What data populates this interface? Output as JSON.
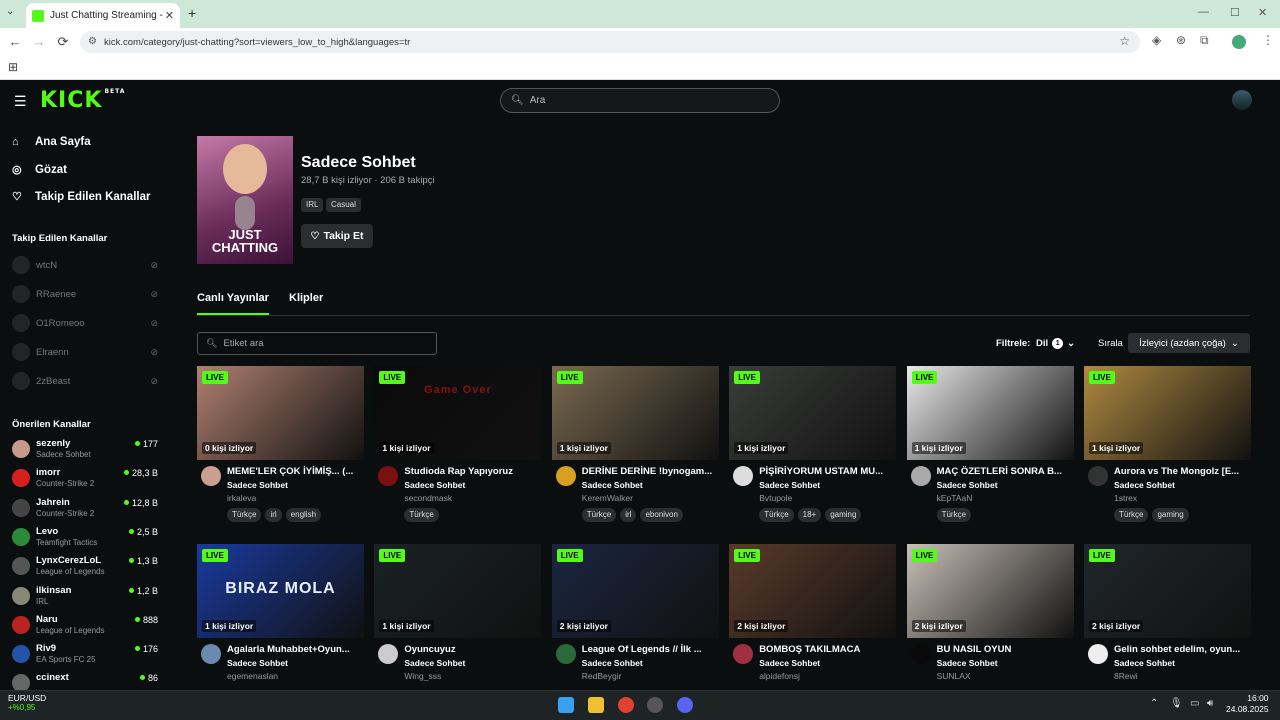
{
  "browser": {
    "tab_title": "Just Chatting Streaming - Live S",
    "tab_close": "✕",
    "new_tab": "+",
    "url": "kick.com/category/just-chatting?sort=viewers_low_to_high&languages=tr",
    "back": "←",
    "forward": "→",
    "reload": "⟳"
  },
  "header": {
    "logo": "KICK",
    "logo_beta": "BETA",
    "search_placeholder": "Ara"
  },
  "sidebar": {
    "nav": [
      {
        "label": "Ana Sayfa",
        "icon": "home-icon"
      },
      {
        "label": "Gözat",
        "icon": "compass-icon"
      },
      {
        "label": "Takip Edilen Kanallar",
        "icon": "heart-icon"
      }
    ],
    "followed_title": "Takip Edilen Kanallar",
    "followed": [
      {
        "name": "wtcN"
      },
      {
        "name": "RRaenee"
      },
      {
        "name": "O1Romeoo"
      },
      {
        "name": "Elraenn"
      },
      {
        "name": "2zBeast"
      }
    ],
    "recommended_title": "Önerilen Kanallar",
    "recommended": [
      {
        "name": "sezenly",
        "category": "Sadece Sohbet",
        "viewers": "177",
        "color": "#c89a8a"
      },
      {
        "name": "imorr",
        "category": "Counter-Strike 2",
        "viewers": "28,3 B",
        "color": "#d62020"
      },
      {
        "name": "Jahrein",
        "category": "Counter-Strike 2",
        "viewers": "12,8 B",
        "color": "#444"
      },
      {
        "name": "Levo",
        "category": "Teamfight Tactics",
        "viewers": "2,5 B",
        "color": "#2a8a3a"
      },
      {
        "name": "LynxCerezLoL",
        "category": "League of Legends",
        "viewers": "1,3 B",
        "color": "#555"
      },
      {
        "name": "ilkinsan",
        "category": "IRL",
        "viewers": "1,2 B",
        "color": "#887"
      },
      {
        "name": "Naru",
        "category": "League of Legends",
        "viewers": "888",
        "color": "#b22"
      },
      {
        "name": "Riv9",
        "category": "EA Sports FC 25",
        "viewers": "176",
        "color": "#2255aa"
      },
      {
        "name": "ccinext",
        "category": "",
        "viewers": "86",
        "color": "#666"
      }
    ]
  },
  "category": {
    "image_text": "JUST CHATTING",
    "title": "Sadece Sohbet",
    "stats": "28,7 B kişi izliyor · 206 B takipçi",
    "tags": [
      "IRL",
      "Casual"
    ],
    "follow_label": "Takip Et"
  },
  "tabs": [
    "Canlı Yayınlar",
    "Klipler"
  ],
  "filters": {
    "tag_search_placeholder": "Etiket ara",
    "filter_label": "Filtrele:",
    "lang_label": "Dil",
    "lang_count": "1",
    "sort_label": "Sırala",
    "sort_value": "İzleyici (azdan çoğa)"
  },
  "live_badge": "LIVE",
  "streams": [
    {
      "title": "MEME'LER ÇOK İYİMİŞ... (...",
      "category": "Sadece Sohbet",
      "user": "irkaleva",
      "viewers": "0 kişi izliyor",
      "tags": [
        "Türkçe",
        "irl",
        "english"
      ],
      "thumb": "#b08070",
      "avatar": "#c9a090"
    },
    {
      "title": "Studioda Rap Yapıyoruz",
      "category": "Sadece Sohbet",
      "user": "secondmask",
      "viewers": "1 kişi izliyor",
      "tags": [
        "Türkçe"
      ],
      "thumb": "#0a0a0a",
      "avatar": "#7a1010",
      "overlay": "Game Over"
    },
    {
      "title": "DERİNE DERİNE !bynogam...",
      "category": "Sadece Sohbet",
      "user": "KeremWalker",
      "viewers": "1 kişi izliyor",
      "tags": [
        "Türkçe",
        "irl",
        "ebonivon"
      ],
      "thumb": "#7a6a50",
      "avatar": "#d8a020"
    },
    {
      "title": "PİŞİRİYORUM USTAM MU...",
      "category": "Sadece Sohbet",
      "user": "Bvtupole",
      "viewers": "1 kişi izliyor",
      "tags": [
        "Türkçe",
        "18+",
        "gaming"
      ],
      "thumb": "#3a3d3a",
      "avatar": "#ddd"
    },
    {
      "title": "MAÇ ÖZETLERİ SONRA B...",
      "category": "Sadece Sohbet",
      "user": "kEpTAaN",
      "viewers": "1 kişi izliyor",
      "tags": [
        "Türkçe"
      ],
      "thumb": "#e8e8e8",
      "avatar": "#aaa"
    },
    {
      "title": "Aurora vs The Mongolz [E...",
      "category": "Sadece Sohbet",
      "user": "1strex",
      "viewers": "1 kişi izliyor",
      "tags": [
        "Türkçe",
        "gaming"
      ],
      "thumb": "#b08a40",
      "avatar": "#333"
    },
    {
      "title": "Agalarla Muhabbet+Oyun...",
      "category": "Sadece Sohbet",
      "user": "egemenaslan",
      "viewers": "1 kişi izliyor",
      "tags": [],
      "thumb": "#1a3aa0",
      "avatar": "#6a8ab0",
      "overlay": "BIRAZ MOLA"
    },
    {
      "title": "Oyuncuyuz",
      "category": "Sadece Sohbet",
      "user": "Wing_sss",
      "viewers": "1 kişi izliyor",
      "tags": [],
      "thumb": "#1a2224",
      "avatar": "#ccc"
    },
    {
      "title": "League Of Legends // İlk ...",
      "category": "Sadece Sohbet",
      "user": "RedBeygir",
      "viewers": "2 kişi izliyor",
      "tags": [],
      "thumb": "#1a2540",
      "avatar": "#2a6a3a"
    },
    {
      "title": "BOMBOŞ TAKILMACA",
      "category": "Sadece Sohbet",
      "user": "alpidefonsj",
      "viewers": "2 kişi izliyor",
      "tags": [],
      "thumb": "#5a3a2a",
      "avatar": "#a03040"
    },
    {
      "title": "BU NASIL OYUN",
      "category": "Sadece Sohbet",
      "user": "SUNLAX",
      "viewers": "2 kişi izliyor",
      "tags": [],
      "thumb": "#c8c0b8",
      "avatar": "#0a0a0a"
    },
    {
      "title": "Gelin sohbet edelim, oyun...",
      "category": "Sadece Sohbet",
      "user": "8Rewi",
      "viewers": "2 kişi izliyor",
      "tags": [],
      "thumb": "#20262a",
      "avatar": "#eee"
    }
  ],
  "taskbar": {
    "ticker": "EUR/USD",
    "ticker_change": "+%0,95",
    "time": "16:00",
    "date": "24.08.2025"
  }
}
